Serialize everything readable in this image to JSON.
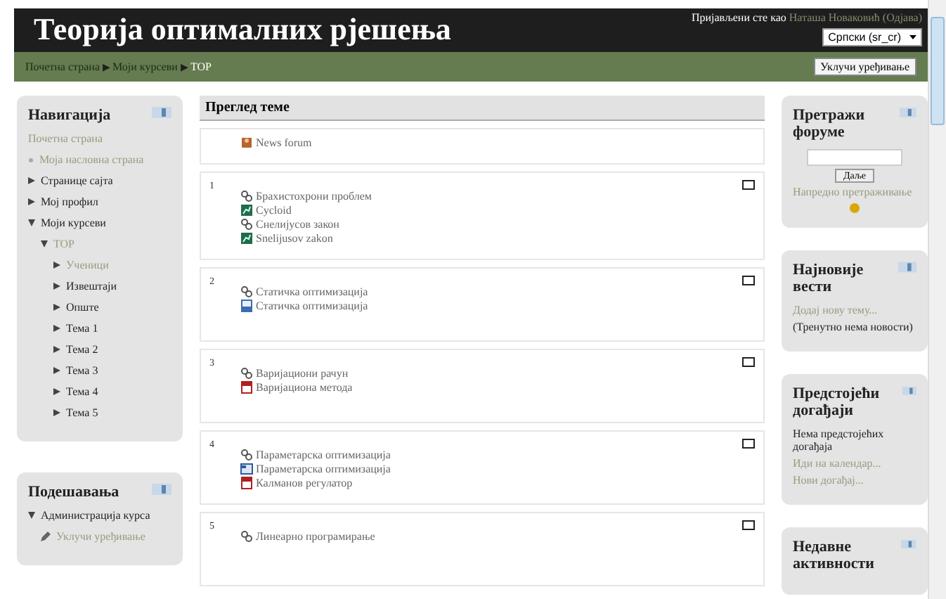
{
  "header": {
    "title": "Теорија оптималних рјешења",
    "login_prefix": "Пријављени сте као",
    "user": "Наташа Новаковић",
    "logout": "(Одјава)",
    "language": "Српски (sr_cr)"
  },
  "breadcrumb": {
    "separator": "▶",
    "items": [
      "Почетна страна",
      "Моји курсеви",
      "TOP"
    ],
    "button": "Уклучи уређивање"
  },
  "navigation": {
    "title": "Навигација",
    "items": [
      {
        "label": "Почетна страна",
        "kind": "plain",
        "muted": true
      },
      {
        "label": "Моја насловна страна",
        "kind": "bullet",
        "muted": true
      },
      {
        "label": "Странице сајта",
        "kind": "branch",
        "expanded": false,
        "muted": false
      },
      {
        "label": "Мој профил",
        "kind": "branch",
        "expanded": false,
        "muted": false
      },
      {
        "label": "Моји курсеви",
        "kind": "branch",
        "expanded": true,
        "muted": false,
        "children": [
          {
            "label": "TOP",
            "kind": "branch",
            "expanded": true,
            "muted": true,
            "children": [
              {
                "label": "Ученици",
                "kind": "branch",
                "expanded": false,
                "muted": true
              },
              {
                "label": "Извештаји",
                "kind": "branch",
                "expanded": false,
                "muted": false
              },
              {
                "label": "Опште",
                "kind": "branch",
                "expanded": false,
                "muted": false
              },
              {
                "label": "Тема 1",
                "kind": "branch",
                "expanded": false,
                "muted": false
              },
              {
                "label": "Тема 2",
                "kind": "branch",
                "expanded": false,
                "muted": false
              },
              {
                "label": "Тема 3",
                "kind": "branch",
                "expanded": false,
                "muted": false
              },
              {
                "label": "Тема 4",
                "kind": "branch",
                "expanded": false,
                "muted": false
              },
              {
                "label": "Тема 5",
                "kind": "branch",
                "expanded": false,
                "muted": false
              }
            ]
          }
        ]
      }
    ]
  },
  "settings": {
    "title": "Подешавања",
    "items": [
      {
        "label": "Администрација курса",
        "kind": "branch",
        "expanded": true,
        "muted": false,
        "children": [
          {
            "label": "Уклучи уређивање",
            "kind": "edit",
            "muted": true
          }
        ]
      }
    ]
  },
  "topics": {
    "title": "Преглед теме",
    "sections": [
      {
        "items": [
          {
            "kind": "forum",
            "label": "News forum"
          }
        ]
      },
      {
        "number": "1",
        "items": [
          {
            "kind": "glossary",
            "label": "Брахистохрони проблем"
          },
          {
            "kind": "chart",
            "label": "Cycloid"
          },
          {
            "kind": "glossary",
            "label": "Снелијусов закон"
          },
          {
            "kind": "chart",
            "label": "Snelijusov zakon"
          }
        ]
      },
      {
        "number": "2",
        "items": [
          {
            "kind": "glossary",
            "label": "Статичка оптимизација"
          },
          {
            "kind": "file",
            "label": "Статичка оптимизација"
          }
        ]
      },
      {
        "number": "3",
        "items": [
          {
            "kind": "glossary",
            "label": "Варијациони рачун"
          },
          {
            "kind": "pdf",
            "label": "Варијациона метода"
          }
        ]
      },
      {
        "number": "4",
        "items": [
          {
            "kind": "glossary",
            "label": "Параметарска оптимизација"
          },
          {
            "kind": "doc",
            "label": "Параметарска оптимизација"
          },
          {
            "kind": "pdf",
            "label": "Калманов регулатор"
          }
        ]
      },
      {
        "number": "5",
        "items": [
          {
            "kind": "glossary",
            "label": "Линеарно програмирање"
          }
        ]
      }
    ]
  },
  "search_forums": {
    "title": "Претражи форуме",
    "button": "Даље",
    "link": "Напредно претраживање"
  },
  "latest_news": {
    "title": "Најновије вести",
    "link": "Додај нову тему...",
    "note": "(Тренутно нема новости)"
  },
  "upcoming_events": {
    "title": "Предстојећи догађаји",
    "note": "Нема предстојећих догађаја",
    "links": [
      "Иди на календар...",
      "Нови догађај..."
    ]
  },
  "recent_activity": {
    "title": "Недавне активности"
  }
}
